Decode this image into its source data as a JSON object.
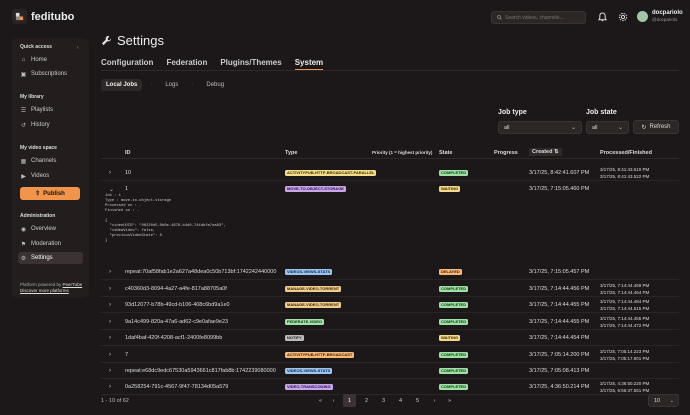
{
  "app": {
    "brand": "feditubo"
  },
  "header": {
    "search_placeholder": "Search videos, channels...",
    "user_name": "docpariolo",
    "user_handle": "@docpariolo"
  },
  "sidebar": {
    "quick_access": "Quick access",
    "items_quick": [
      "Home",
      "Subscriptions"
    ],
    "my_library": "My library",
    "items_library": [
      "Playlists",
      "History"
    ],
    "my_video_space": "My video space",
    "items_space": [
      "Channels",
      "Videos"
    ],
    "publish": "Publish",
    "administration": "Administration",
    "items_admin": [
      "Overview",
      "Moderation",
      "Settings"
    ],
    "footer_line1": "Platform powered by",
    "footer_link1": "PeerTube",
    "footer_link2": "Discover more platforms"
  },
  "page": {
    "title": "Settings"
  },
  "tabs": [
    "Configuration",
    "Federation",
    "Plugins/Themes",
    "System"
  ],
  "subtabs": [
    "Local Jobs",
    "Logs",
    "Debug"
  ],
  "filters": {
    "job_type_label": "Job type",
    "job_type_value": "all",
    "job_state_label": "Job state",
    "job_state_value": "all",
    "refresh": "Refresh"
  },
  "table": {
    "headers": {
      "id": "ID",
      "type": "Type",
      "priority": "Priority (1 = highest priority)",
      "state": "State",
      "progress": "Progress",
      "created": "Created",
      "processed": "Processed/Finished"
    },
    "detail": "Job : 1\nType : move-to-object-storage\nProcessed on : -\nFinished on : -\n\n{\n  \"videoUUID\": \"00220d5-0b0e-4678-b4d0-744dbfa7ea83\",\n  \"isNewVideo\": false,\n  \"previousVideoState\": 0\n}",
    "rows": [
      {
        "id": "10",
        "type": "ACTIVITYPUB-HTTP-BROADCAST-PARALLEL",
        "state": "COMPLETED",
        "created": "3/17/25, 8:42:41.607 PM",
        "processed": [
          "3/17/25, 8:41:43.610 PM",
          "3/17/25, 8:41:43.522 PM"
        ]
      },
      {
        "id": "1",
        "type": "MOVE-TO-OBJECT-STORAGE",
        "state": "WAITING",
        "created": "3/17/25, 7:15:05.460 PM",
        "processed": []
      },
      {
        "id": "repeat:70af58fab1e2a627a48dea0c50b713bf:1742242440000",
        "type": "VIDEOS-VIEWS-STATS",
        "state": "DELAYED",
        "created": "3/17/25, 7:15:05.457 PM",
        "processed": []
      },
      {
        "id": "c40360d3-8094-4a27-a4fe-817a88705a0f",
        "type": "MANAGE-VIDEO-TORRENT",
        "state": "COMPLETED",
        "created": "3/17/25, 7:14:44.456 PM",
        "processed": [
          "3/17/25, 7:14:44.459 PM",
          "3/17/25, 7:14:44.464 PM"
        ]
      },
      {
        "id": "93d12077-b78b-49cd-b106-408c6bd9a1e0",
        "type": "MANAGE-VIDEO-TORRENT",
        "state": "COMPLETED",
        "created": "3/17/25, 7:14:44.455 PM",
        "processed": [
          "3/17/25, 7:14:44.484 PM",
          "3/17/25, 7:14:44.515 PM"
        ]
      },
      {
        "id": "9a14c499-820a-47a6-ad62-c9e0afae9e23",
        "type": "FEDERATE-VIDEO",
        "state": "COMPLETED",
        "created": "3/17/25, 7:14:44.455 PM",
        "processed": [
          "3/17/25, 7:14:44.455 PM",
          "3/17/25, 7:14:44.472 PM"
        ]
      },
      {
        "id": "1daf4baf-420f-4208-acf1-2400fe8099bb",
        "type": "NOTIFY",
        "state": "WAITING",
        "created": "3/17/25, 7:14:44.454 PM",
        "processed": []
      },
      {
        "id": "7",
        "type": "ACTIVITYPUB-HTTP-BROADCAST",
        "state": "COMPLETED",
        "created": "3/17/25, 7:05:14.200 PM",
        "processed": [
          "3/17/25, 7:05:14.223 PM",
          "3/17/25, 7:05:17.901 PM"
        ]
      },
      {
        "id": "repeat:e68dc9edc67530a5943661c817fab8b:1742239080000",
        "type": "VIDEOS-VIEWS-STATS",
        "state": "COMPLETED",
        "created": "3/17/25, 7:05:08.413 PM",
        "processed": []
      },
      {
        "id": "0a258254-791c-4567-9f47-78134d05a579",
        "type": "VIDEO-TRANSCODING",
        "state": "COMPLETED",
        "created": "3/17/25, 4:36:50.214 PM",
        "processed": [
          "3/17/25, 4:36:50.220 PM",
          "3/17/25, 6:56:37.551 PM"
        ]
      }
    ]
  },
  "pagination": {
    "info": "1 - 10 of 62",
    "pages": [
      "1",
      "2",
      "3",
      "4",
      "5"
    ],
    "per_page": "10"
  },
  "colors": {
    "accent": "#f2944a",
    "bg": "#1c1718"
  }
}
